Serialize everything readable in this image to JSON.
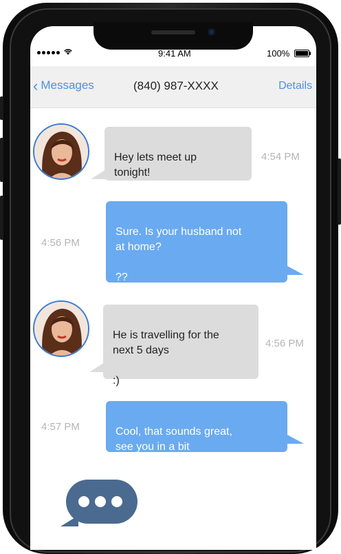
{
  "status_bar": {
    "time": "9:41 AM",
    "battery": "100%"
  },
  "nav": {
    "back_label": "Messages",
    "title": "(840) 987-XXXX",
    "details_label": "Details"
  },
  "messages": [
    {
      "direction": "in",
      "text": "Hey lets meet up\ntonight!",
      "time": "4:54 PM"
    },
    {
      "direction": "out",
      "text": "Sure. Is your husband not\nat home?\n\n??",
      "time": "4:56 PM"
    },
    {
      "direction": "in",
      "text": "He is travelling for the\nnext 5 days\n\n:)",
      "time": "4:56 PM"
    },
    {
      "direction": "out",
      "text": "Cool, that sounds great,\nsee you in a bit",
      "time": "4:57 PM"
    }
  ],
  "colors": {
    "accent": "#4a90e2",
    "outgoing_bubble": "#6aaaf0",
    "incoming_bubble": "#dcdcdc",
    "typing_bubble": "#4b6a8f"
  }
}
